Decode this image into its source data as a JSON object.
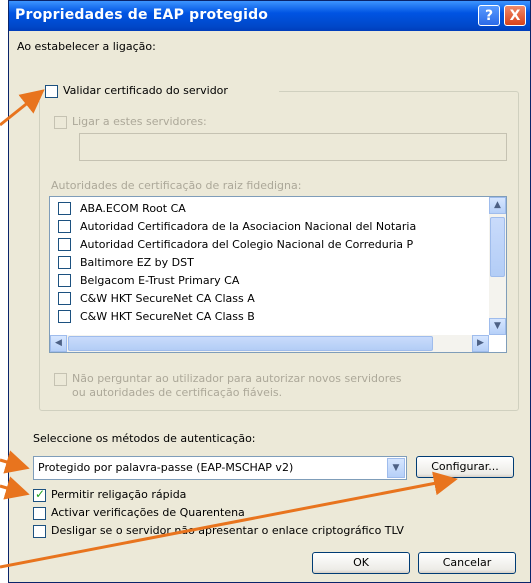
{
  "window": {
    "title": "Propriedades de EAP protegido",
    "help_glyph": "?",
    "close_glyph": "X"
  },
  "connect": {
    "heading": "Ao estabelecer a ligação:",
    "validate_cert": "Validar certificado do servidor",
    "connect_servers": "Ligar a estes servidores:",
    "servers_value": "",
    "trusted_root_label": "Autoridades de certificação de raiz fidedigna:"
  },
  "certificates": [
    {
      "name": "ABA.ECOM Root CA",
      "checked": false
    },
    {
      "name": "Autoridad Certificadora de la Asociacion Nacional del Notaria",
      "checked": false
    },
    {
      "name": "Autoridad Certificadora del Colegio Nacional de Correduria P",
      "checked": false
    },
    {
      "name": "Baltimore EZ by DST",
      "checked": false
    },
    {
      "name": "Belgacom E-Trust Primary CA",
      "checked": false
    },
    {
      "name": "C&W HKT SecureNet CA Class A",
      "checked": false
    },
    {
      "name": "C&W HKT SecureNet CA Class B",
      "checked": false
    }
  ],
  "no_prompt": {
    "line1": "Não perguntar ao utilizador para autorizar novos servidores",
    "line2": "ou autoridades de certificação fiáveis."
  },
  "auth": {
    "heading": "Seleccione os métodos de autenticação:",
    "method": "Protegido por palavra-passe (EAP-MSCHAP v2)",
    "configure_button": "Configurar..."
  },
  "options": {
    "fast_reconnect": {
      "label": "Permitir religação rápida",
      "checked": true
    },
    "quarantine": {
      "label": "Activar verificações de Quarentena",
      "checked": false
    },
    "disconnect_tlv": {
      "label": "Desligar se o servidor não apresentar o enlace criptográfico TLV",
      "checked": false
    }
  },
  "footer": {
    "ok": "OK",
    "cancel": "Cancelar"
  },
  "colors": {
    "arrow": "#e8741e",
    "titlebar": "#0054e3",
    "dialog_bg": "#ece9d8"
  }
}
